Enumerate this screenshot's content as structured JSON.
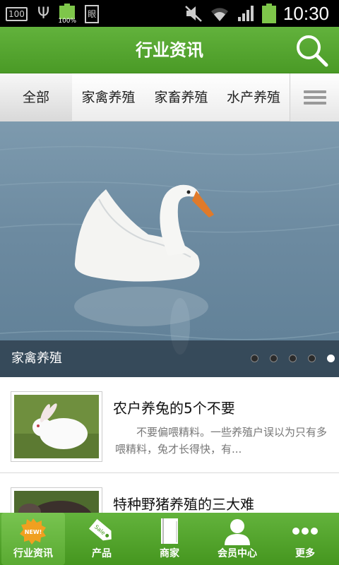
{
  "status_bar": {
    "badge_text": "100",
    "battery_percent_text": "100%",
    "doc_icon_text": "眼",
    "time": "10:30",
    "icons": [
      "badge-icon",
      "usb-icon",
      "battery-icon",
      "document-icon",
      "mute-icon",
      "wifi-icon",
      "signal-icon",
      "battery-icon"
    ]
  },
  "header": {
    "title": "行业资讯",
    "search_icon": "search-icon"
  },
  "tabs": {
    "items": [
      {
        "label": "全部",
        "active": true
      },
      {
        "label": "家禽养殖",
        "active": false
      },
      {
        "label": "家畜养殖",
        "active": false
      },
      {
        "label": "水产养殖",
        "active": false
      }
    ],
    "menu_icon": "hamburger-menu-icon"
  },
  "banner": {
    "caption": "家禽养殖",
    "slide_count": 5,
    "active_slide": 5
  },
  "news": {
    "items": [
      {
        "title": "农户养兔的5个不要",
        "summary": "不要偏喂精料。一些养殖户误以为只有多喂精料，兔才长得快，有..."
      },
      {
        "title": "特种野猪养殖的三大难",
        "summary": ""
      }
    ]
  },
  "bottom_nav": {
    "items": [
      {
        "label": "行业资讯",
        "icon": "new-badge-icon",
        "active": true
      },
      {
        "label": "产品",
        "icon": "sale-tag-icon",
        "active": false
      },
      {
        "label": "商家",
        "icon": "book-icon",
        "active": false
      },
      {
        "label": "会员中心",
        "icon": "user-icon",
        "active": false
      },
      {
        "label": "更多",
        "icon": "more-dots-icon",
        "active": false
      }
    ]
  },
  "colors": {
    "brand_green": "#56a52f",
    "header_text": "#ffffff",
    "status_bar_bg": "#000000"
  }
}
